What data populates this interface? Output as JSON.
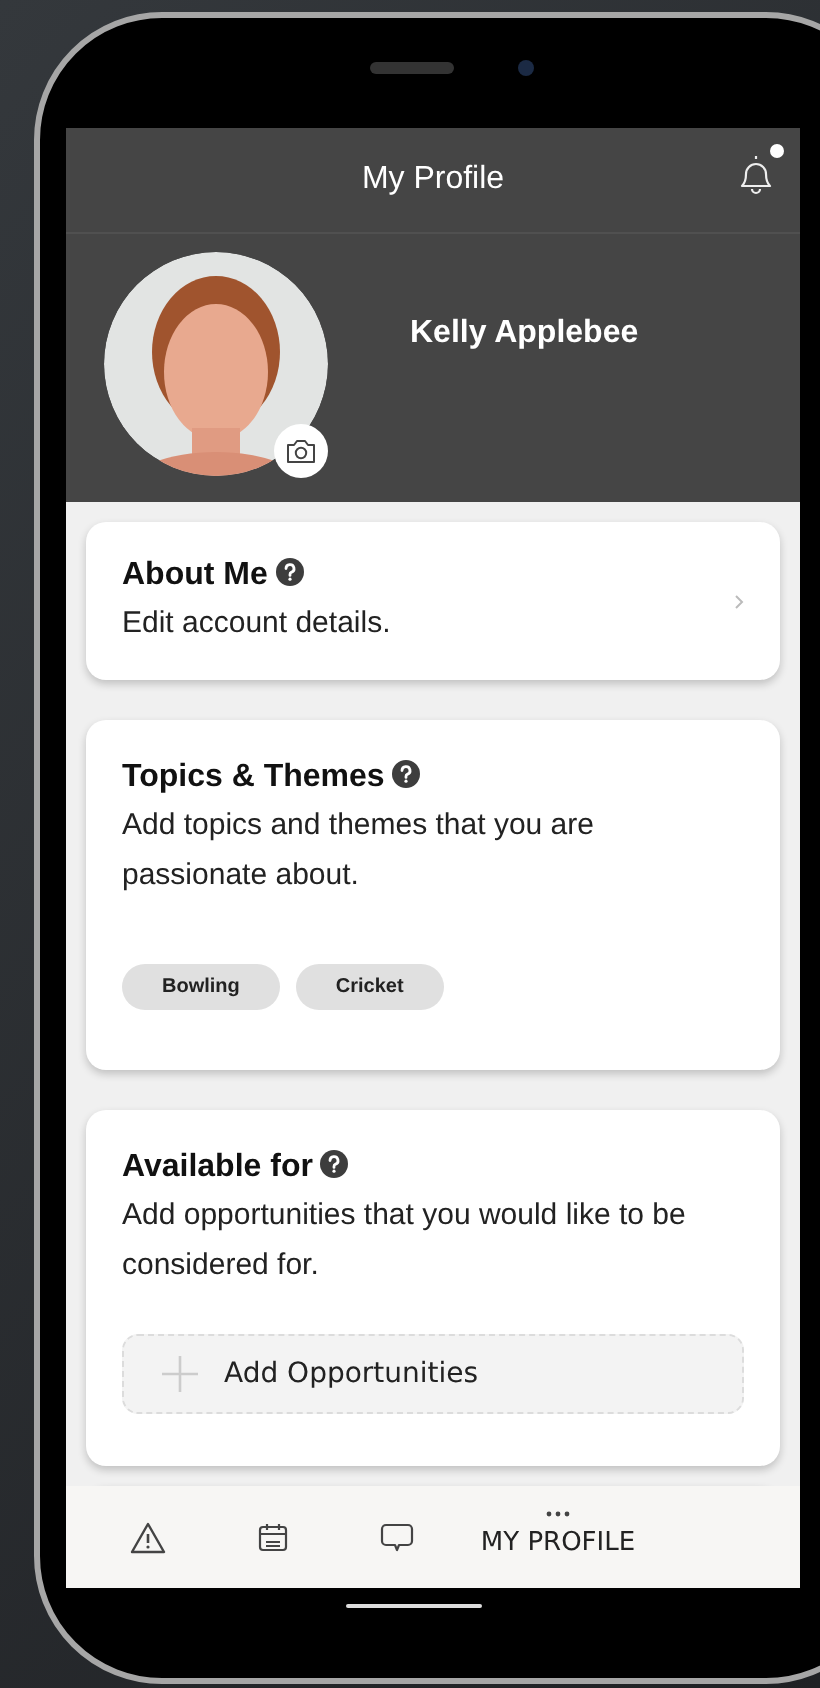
{
  "header": {
    "title": "My Profile",
    "notification_dot": true
  },
  "profile": {
    "name": "Kelly Applebee"
  },
  "cards": [
    {
      "kind": "link",
      "title": "About Me",
      "description": "Edit account details."
    },
    {
      "kind": "tags",
      "title": "Topics & Themes",
      "description": "Add topics and themes that you are passionate about.",
      "tags": [
        "Bowling",
        "Cricket"
      ]
    },
    {
      "kind": "add",
      "title": "Available for",
      "description": "Add opportunities that you would like to be considered for.",
      "button": "Add Opportunities"
    }
  ],
  "tab_bar": [
    {
      "kind": "alert",
      "selected": false
    },
    {
      "kind": "calendar",
      "selected": false
    },
    {
      "kind": "chat",
      "selected": false
    },
    {
      "kind": "more",
      "label": "MY PROFILE",
      "selected": true
    }
  ]
}
